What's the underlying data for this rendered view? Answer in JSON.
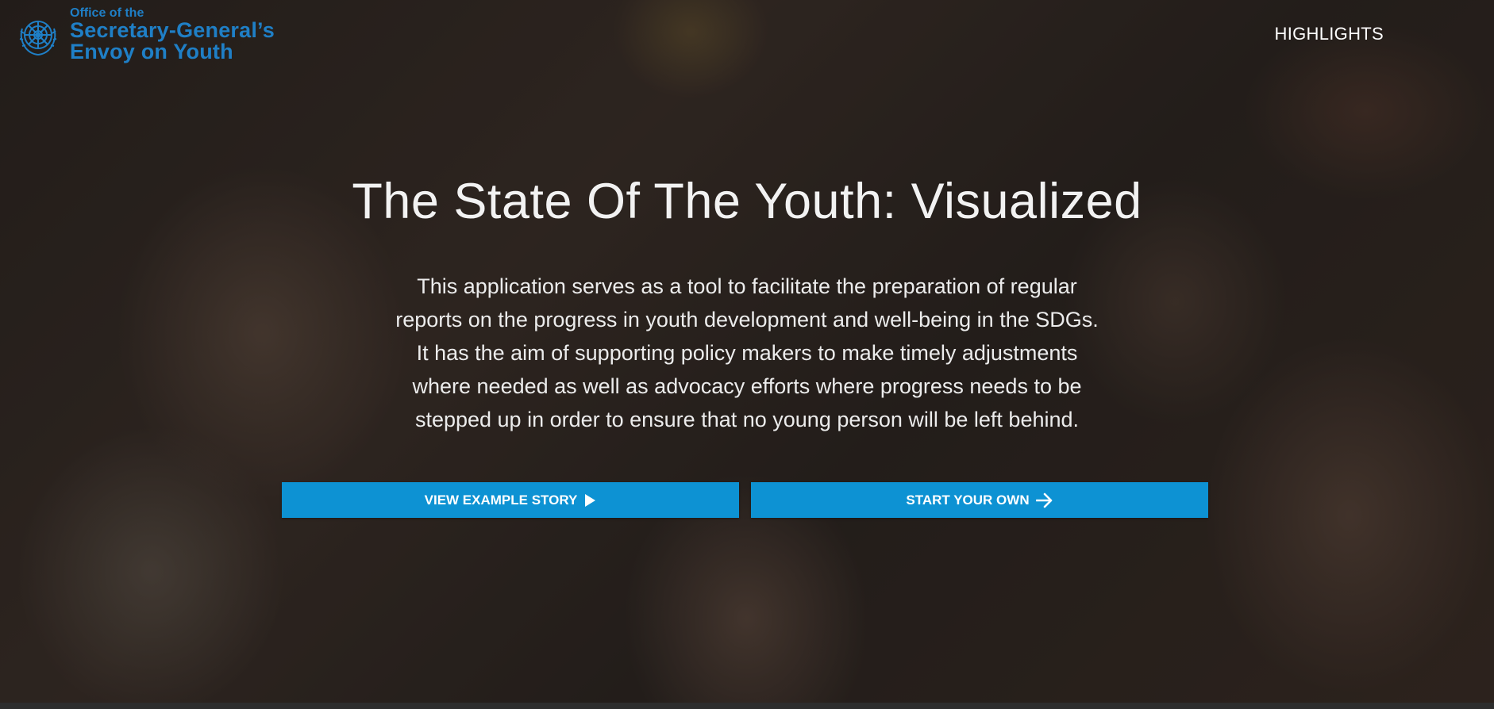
{
  "header": {
    "logo": {
      "line1": "Office of the",
      "line2": "Secretary-General’s",
      "line3": "Envoy on Youth",
      "emblem_icon": "un-emblem-icon"
    },
    "nav": {
      "highlights_label": "HIGHLIGHTS"
    }
  },
  "hero": {
    "title": "The State Of The Youth: Visualized",
    "description_lines": [
      "This application serves as a tool to facilitate the preparation of regular",
      "reports on the progress in youth development and well-being in the SDGs.",
      "It has the aim of supporting policy makers to make timely adjustments",
      "where needed as well as advocacy efforts where progress needs to be",
      "stepped up in order to ensure that no young person will be left behind."
    ],
    "buttons": {
      "view_story_label": "VIEW EXAMPLE STORY",
      "view_story_icon": "play-icon",
      "start_own_label": "START YOUR OWN",
      "start_own_icon": "arrow-right-icon"
    }
  },
  "colors": {
    "brand_blue": "#1f7fc6",
    "button_blue": "#0d92d3",
    "text_white": "#ffffff"
  }
}
